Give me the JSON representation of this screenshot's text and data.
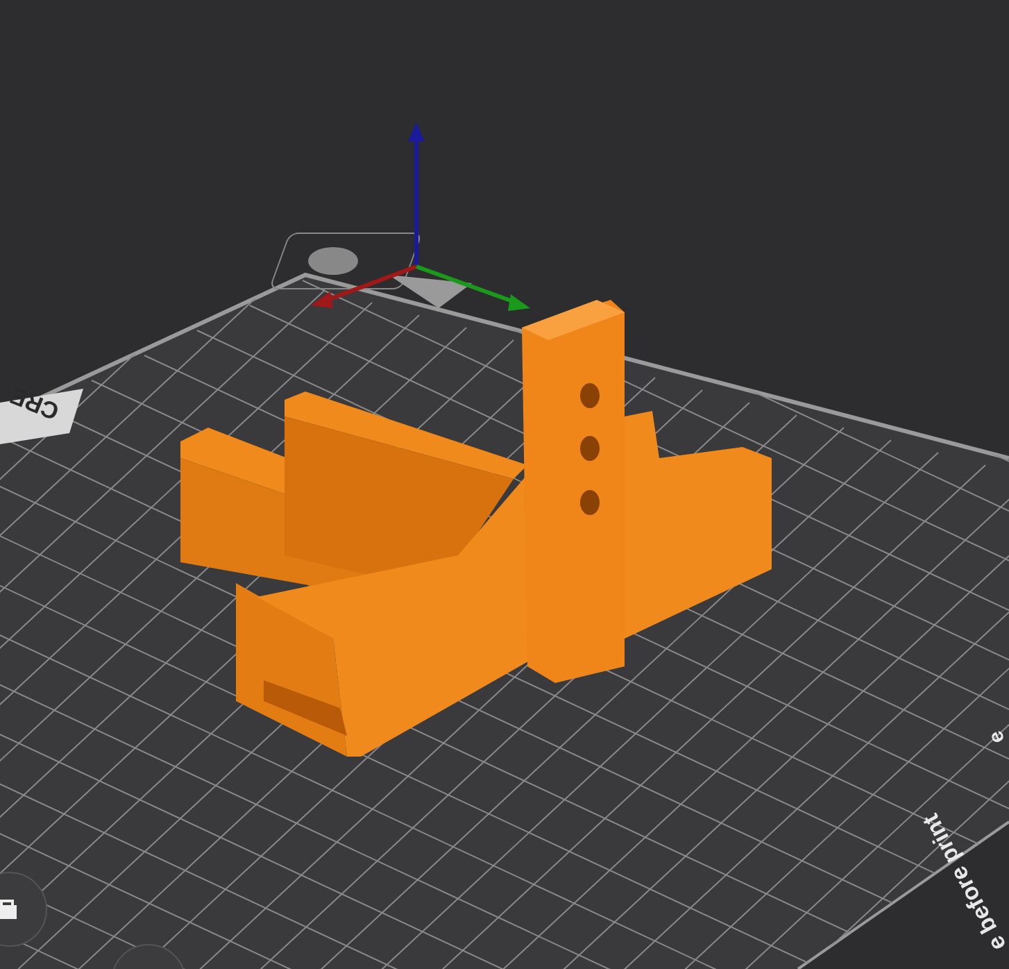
{
  "viewport": {
    "bed_labels": [
      {
        "text": "CRE"
      },
      {
        "text": "e"
      },
      {
        "text": "e before print"
      }
    ]
  }
}
